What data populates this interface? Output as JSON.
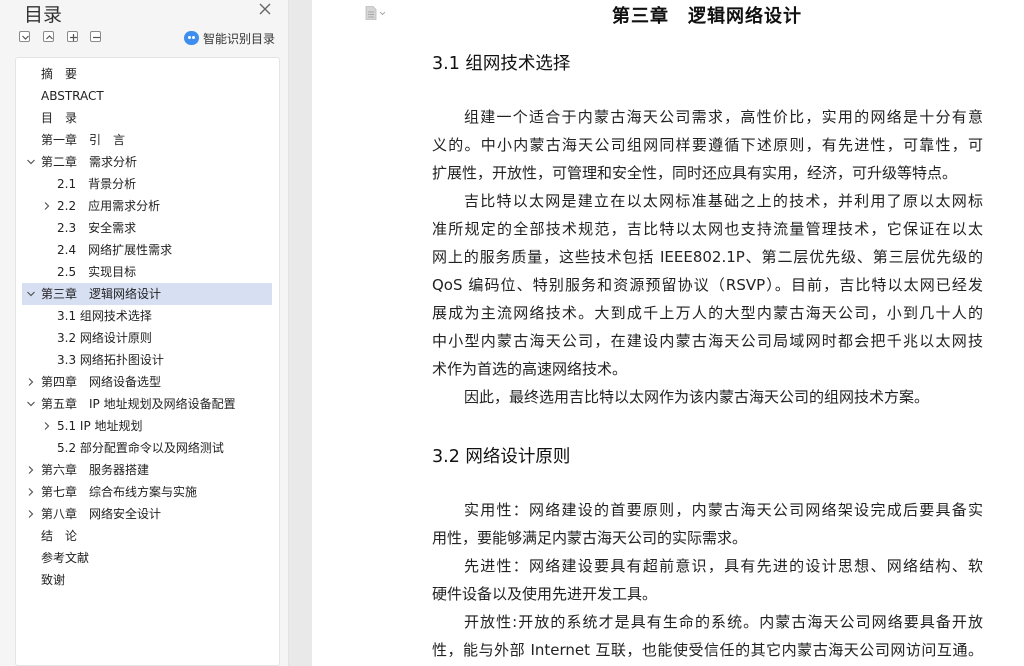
{
  "sidebar": {
    "title": "目录",
    "ai_label": "智能识别目录",
    "items": [
      {
        "label": "摘　要"
      },
      {
        "label": "ABSTRACT"
      },
      {
        "label": "目　录"
      },
      {
        "label": "第一章　引　言"
      },
      {
        "label": "第二章　需求分析"
      },
      {
        "label": "2.1　背景分析"
      },
      {
        "label": "2.2　应用需求分析"
      },
      {
        "label": "2.3　安全需求"
      },
      {
        "label": "2.4　网络扩展性需求"
      },
      {
        "label": "2.5　实现目标"
      },
      {
        "label": "第三章　逻辑网络设计"
      },
      {
        "label": "3.1 组网技术选择"
      },
      {
        "label": "3.2 网络设计原则"
      },
      {
        "label": "3.3 网络拓扑图设计"
      },
      {
        "label": "第四章　网络设备选型"
      },
      {
        "label": "第五章　IP 地址规划及网络设备配置"
      },
      {
        "label": "5.1 IP 地址规划"
      },
      {
        "label": "5.2 部分配置命令以及网络测试"
      },
      {
        "label": "第六章　服务器搭建"
      },
      {
        "label": "第七章　综合布线方案与实施"
      },
      {
        "label": "第八章　网络安全设计"
      },
      {
        "label": "结　论"
      },
      {
        "label": "参考文献"
      },
      {
        "label": "致谢"
      }
    ]
  },
  "document": {
    "chapter_title": "第三章　逻辑网络设计",
    "sections": [
      {
        "heading": "3.1 组网技术选择",
        "lines": [
          "组建一个适合于内蒙古海天公司需求，高性价比，实用的网络是十分有意",
          "义的。中小内蒙古海天公司组网同样要遵循下述原则，有先进性，可靠性，可",
          "扩展性，开放性，可管理和安全性，同时还应具有实用，经济，可升级等特点。",
          "吉比特以太网是建立在以太网标准基础之上的技术，并利用了原以太网标",
          "准所规定的全部技术规范，吉比特以太网也支持流量管理技术，它保证在以太",
          "网上的服务质量，这些技术包括 IEEE802.1P、第二层优先级、第三层优先级的",
          "QoS 编码位、特别服务和资源预留协议（RSVP）。目前，吉比特以太网已经发",
          "展成为主流网络技术。大到成千上万人的大型内蒙古海天公司，小到几十人的",
          "中小型内蒙古海天公司，在建设内蒙古海天公司局域网时都会把千兆以太网技",
          "术作为首选的高速网络技术。",
          "因此，最终选用吉比特以太网作为该内蒙古海天公司的组网技术方案。"
        ]
      },
      {
        "heading": "3.2 网络设计原则",
        "lines": [
          "实用性：网络建设的首要原则，内蒙古海天公司网络架设完成后要具备实",
          "用性，要能够满足内蒙古海天公司的实际需求。",
          "先进性：网络建设要具有超前意识，具有先进的设计思想、网络结构、软",
          "硬件设备以及使用先进开发工具。",
          "开放性:开放的系统才是具有生命的系统。内蒙古海天公司网络要具备开放",
          "性，能与外部 Internet 互联，也能使受信任的其它内蒙古海天公司网访问互通。"
        ]
      }
    ]
  }
}
